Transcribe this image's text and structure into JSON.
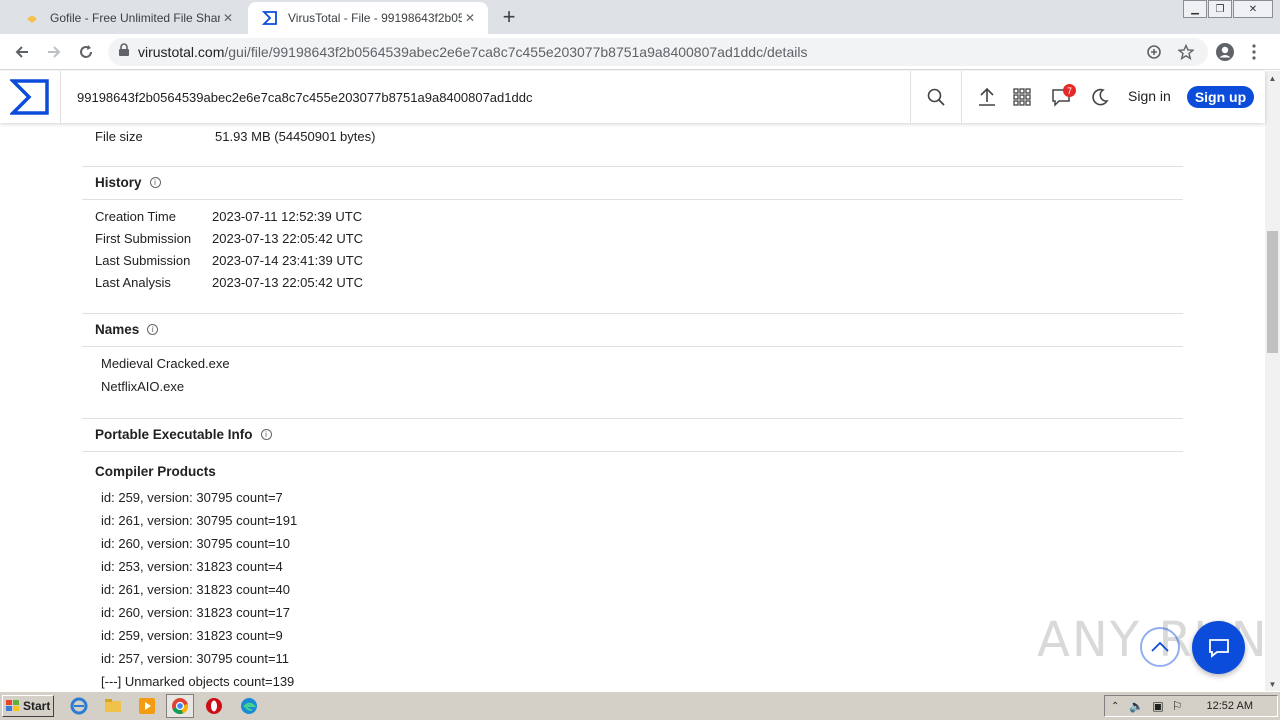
{
  "browser": {
    "tabs": [
      {
        "title": "Gofile - Free Unlimited File Sharing and Storage",
        "active": false
      },
      {
        "title": "VirusTotal - File - 99198643f2b0564539abec2e6e7ca8c7c455e203077b8751a9a8400807ad1ddc",
        "active": true
      }
    ],
    "url_host": "virustotal.com",
    "url_path": "/gui/file/99198643f2b0564539abec2e6e7ca8c7c455e203077b8751a9a8400807ad1ddc/details"
  },
  "header": {
    "search_value": "99198643f2b0564539abec2e6e7ca8c7c455e203077b8751a9a8400807ad1ddc",
    "notification_count": "7",
    "sign_in": "Sign in",
    "sign_up": "Sign up"
  },
  "file_size": {
    "label": "File size",
    "value": "51.93 MB (54450901 bytes)"
  },
  "history": {
    "title": "History",
    "rows": [
      {
        "label": "Creation Time",
        "value": "2023-07-11 12:52:39 UTC"
      },
      {
        "label": "First Submission",
        "value": "2023-07-13 22:05:42 UTC"
      },
      {
        "label": "Last Submission",
        "value": "2023-07-14 23:41:39 UTC"
      },
      {
        "label": "Last Analysis",
        "value": "2023-07-13 22:05:42 UTC"
      }
    ]
  },
  "names": {
    "title": "Names",
    "items": [
      "Medieval Cracked.exe",
      "NetflixAIO.exe"
    ]
  },
  "pe_info": {
    "title": "Portable Executable Info",
    "compiler_title": "Compiler Products",
    "compiler_items": [
      "id: 259, version: 30795 count=7",
      "id: 261, version: 30795 count=191",
      "id: 260, version: 30795 count=10",
      "id: 253, version: 31823 count=4",
      "id: 261, version: 31823 count=40",
      "id: 260, version: 31823 count=17",
      "id: 259, version: 31823 count=9",
      "id: 257, version: 30795 count=11",
      "[---] Unmarked objects count=139"
    ]
  },
  "watermark": "ANY RUN",
  "taskbar": {
    "start": "Start",
    "clock": "12:52 AM"
  },
  "colors": {
    "accent": "#0b4dda",
    "badge": "#e52828"
  }
}
